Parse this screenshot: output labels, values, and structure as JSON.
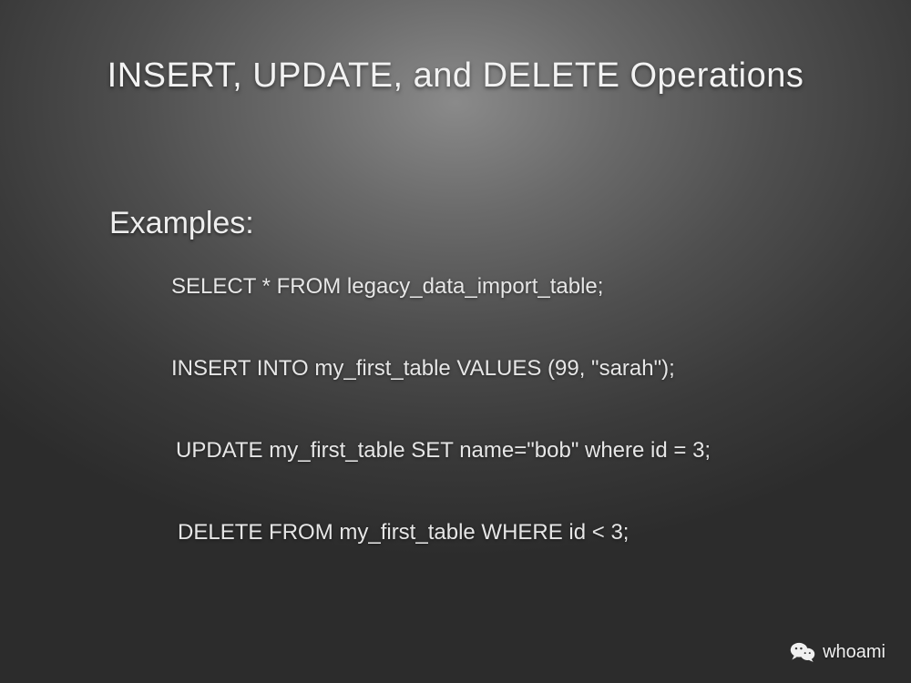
{
  "slide": {
    "title": "INSERT, UPDATE, and DELETE Operations",
    "examples_label": "Examples:",
    "code_lines": {
      "select": "SELECT * FROM legacy_data_import_table;",
      "insert": "INSERT INTO my_first_table VALUES (99, \"sarah\");",
      "update": "UPDATE my_first_table SET name=\"bob\" where id = 3;",
      "delete": "DELETE FROM my_first_table WHERE id < 3;"
    }
  },
  "footer": {
    "username": "whoami"
  }
}
